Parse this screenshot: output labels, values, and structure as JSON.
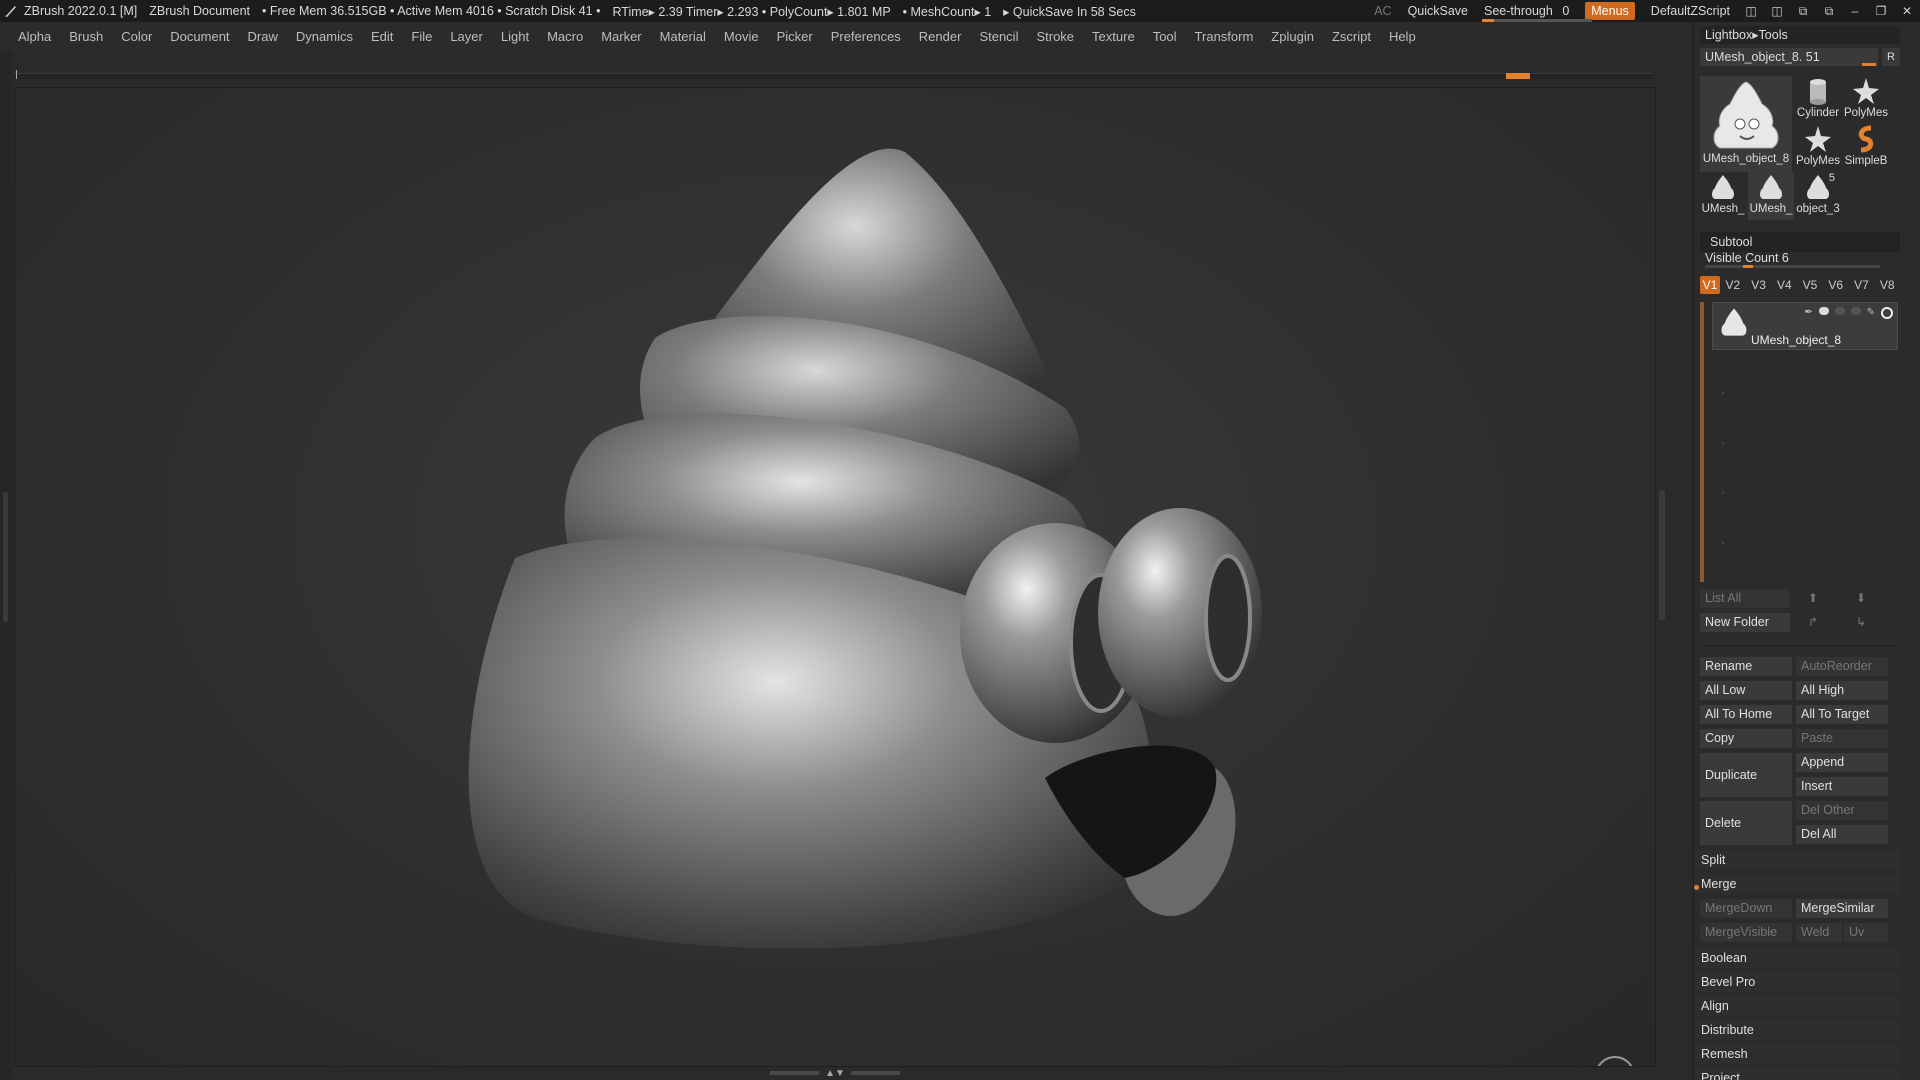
{
  "titlebar": {
    "app": "ZBrush 2022.0.1 [M]",
    "document": "ZBrush Document",
    "stats": "• Free Mem 36.515GB • Active Mem 4016 • Scratch Disk 41 •",
    "rtime": "RTime▸ 2.39 Timer▸ 2.293 • PolyCount▸ 1.801 MP",
    "meshcount": "• MeshCount▸ 1",
    "quicksave_timer": "▸ QuickSave In 58 Secs",
    "ac": "AC",
    "quicksave": "QuickSave",
    "seethrough_label": "See-through",
    "seethrough_value": "0",
    "menus": "Menus",
    "script": "DefaultZScript"
  },
  "menubar": {
    "items": [
      "Alpha",
      "Brush",
      "Color",
      "Document",
      "Draw",
      "Dynamics",
      "Edit",
      "File",
      "Layer",
      "Light",
      "Macro",
      "Marker",
      "Material",
      "Movie",
      "Picker",
      "Preferences",
      "Render",
      "Stencil",
      "Stroke",
      "Texture",
      "Tool",
      "Transform",
      "Zplugin",
      "Zscript",
      "Help"
    ]
  },
  "toolpanel": {
    "lightbox": "Lightbox▸Tools",
    "current_tool": "UMesh_object_8. 51",
    "r_button": "R",
    "thumbs": [
      {
        "label": "UMesh_object_8"
      },
      {
        "label": "Cylinder"
      },
      {
        "label": "PolyMes"
      },
      {
        "label": "PolyMes"
      },
      {
        "label": "SimpleB"
      },
      {
        "label": "UMesh_"
      },
      {
        "label": "UMesh_"
      },
      {
        "label": "object_3",
        "badge": "5"
      }
    ]
  },
  "subtool": {
    "title": "Subtool",
    "visible_count": "Visible Count 6",
    "tabs": [
      "V1",
      "V2",
      "V3",
      "V4",
      "V5",
      "V6",
      "V7",
      "V8"
    ],
    "active_tab": "V1",
    "row_name": "UMesh_object_8",
    "list_all": "List All",
    "new_folder": "New Folder",
    "rename": "Rename",
    "autoreorder": "AutoReorder",
    "all_low": "All Low",
    "all_high": "All High",
    "all_to_home": "All To Home",
    "all_to_target": "All To Target",
    "copy": "Copy",
    "paste": "Paste",
    "duplicate": "Duplicate",
    "append": "Append",
    "insert": "Insert",
    "delete": "Delete",
    "del_other": "Del Other",
    "del_all": "Del All",
    "split": "Split",
    "merge": "Merge",
    "mergedown": "MergeDown",
    "mergesimilar": "MergeSimilar",
    "mergevisible": "MergeVisible",
    "weld": "Weld",
    "uv": "Uv",
    "boolean": "Boolean",
    "bevel_pro": "Bevel Pro",
    "align": "Align",
    "distribute": "Distribute",
    "remesh": "Remesh",
    "project": "Project"
  },
  "colors": {
    "accent": "#d06a1e",
    "background": "#2a2a2a",
    "panel": "#2b2b2b"
  }
}
